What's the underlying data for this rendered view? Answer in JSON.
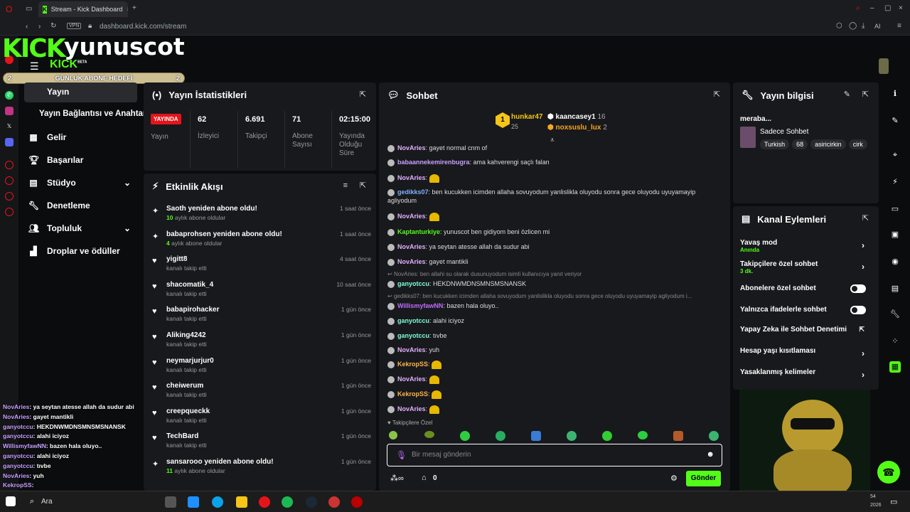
{
  "browser": {
    "tab_title": "Stream - Kick Dashboard",
    "vpn": "VPN",
    "url": "dashboard.kick.com/stream",
    "ai": "AI"
  },
  "header": {
    "logo": "KICK",
    "username": "yunuscot",
    "logo_small": "KICK",
    "beta": "BETA",
    "sub_goal_label": "GÜNLÜK ABONE HEDEFİ",
    "sub_goal_left": "2",
    "sub_goal_right": "2"
  },
  "nav": {
    "items": [
      {
        "label": "Yayın"
      },
      {
        "label": "Yayın Bağlantısı ve Anahtarı"
      },
      {
        "label": "Gelir"
      },
      {
        "label": "Başarılar"
      },
      {
        "label": "Stüdyo"
      },
      {
        "label": "Denetleme"
      },
      {
        "label": "Topluluk"
      },
      {
        "label": "Droplar ve ödüller"
      }
    ]
  },
  "stats": {
    "title": "Yayın İstatistikleri",
    "live_badge": "YAYINDA",
    "live_label": "Yayın",
    "items": [
      {
        "value": "62",
        "label": "İzleyici"
      },
      {
        "value": "6.691",
        "label": "Takipçi"
      },
      {
        "value": "71",
        "label": "Abone Sayısı"
      },
      {
        "value": "02:15:00",
        "label": "Yayında Olduğu Süre"
      }
    ]
  },
  "activity": {
    "title": "Etkinlik Akışı",
    "items": [
      {
        "name": "Saoth yeniden abone oldu!",
        "count": "10",
        "sub": "aylık abone oldular",
        "time": "1 saat önce",
        "icon": "sparkle-icon"
      },
      {
        "name": "babaprohsen yeniden abone oldu!",
        "count": "4",
        "sub": "aylık abone oldular",
        "time": "1 saat önce",
        "icon": "sparkle-icon"
      },
      {
        "name": "yigitt8",
        "count": "",
        "sub": "kanalı takip etti",
        "time": "4 saat önce",
        "icon": "heart-icon"
      },
      {
        "name": "shacomatik_4",
        "count": "",
        "sub": "kanalı takip etti",
        "time": "10 saat önce",
        "icon": "heart-icon"
      },
      {
        "name": "babapirohacker",
        "count": "",
        "sub": "kanalı takip etti",
        "time": "1 gün önce",
        "icon": "heart-icon"
      },
      {
        "name": "Aliking4242",
        "count": "",
        "sub": "kanalı takip etti",
        "time": "1 gün önce",
        "icon": "heart-icon"
      },
      {
        "name": "neymarjurjur0",
        "count": "",
        "sub": "kanalı takip etti",
        "time": "1 gün önce",
        "icon": "heart-icon"
      },
      {
        "name": "cheiwerum",
        "count": "",
        "sub": "kanalı takip etti",
        "time": "1 gün önce",
        "icon": "heart-icon"
      },
      {
        "name": "creepqueckk",
        "count": "",
        "sub": "kanalı takip etti",
        "time": "1 gün önce",
        "icon": "heart-icon"
      },
      {
        "name": "TechBard",
        "count": "",
        "sub": "kanalı takip etti",
        "time": "1 gün önce",
        "icon": "heart-icon"
      },
      {
        "name": "sansarooo yeniden abone oldu!",
        "count": "11",
        "sub": "aylık abone oldular",
        "time": "1 gün önce",
        "icon": "sparkle-icon"
      }
    ]
  },
  "chat": {
    "title": "Sohbet",
    "top": [
      {
        "rank": "1",
        "name": "hunkar47",
        "val": "25"
      },
      {
        "rank": "2",
        "name": "kaancasey1",
        "val": "16"
      },
      {
        "rank": "3",
        "name": "noxsuslu_lux",
        "val": "2"
      }
    ],
    "messages": [
      {
        "user": "NovAries",
        "color": "#e0b0ff",
        "text": "gayet normal cnm of",
        "kind": "msg"
      },
      {
        "user": "babaannekemirenbugra",
        "color": "#c9a0ff",
        "text": "ama kahverengi saçlı falan",
        "kind": "msg"
      },
      {
        "user": "NovAries",
        "color": "#e0b0ff",
        "text": "",
        "kind": "msg"
      },
      {
        "user": "gedikks07",
        "color": "#7fb2ff",
        "text": "ben kucukken icimden allaha sovuyodum yanlislikla oluyodu sonra gece oluyodu uyuyamayip agliyodum",
        "kind": "msg"
      },
      {
        "user": "NovAries",
        "color": "#e0b0ff",
        "text": "",
        "kind": "msg"
      },
      {
        "user": "Kaptanturkiye",
        "color": "#53fc18",
        "text": "yunuscot ben gidiyom beni özlicen mi",
        "kind": "msg"
      },
      {
        "user": "NovAries",
        "color": "#e0b0ff",
        "text": "ya seytan atesse allah da sudur abi",
        "kind": "msg"
      },
      {
        "user": "NovAries",
        "color": "#e0b0ff",
        "text": "gayet mantikli",
        "kind": "msg"
      },
      {
        "user": "",
        "color": "#888",
        "text": "NovAries: ben allahi su olarak dusunuyodum isimli kullanıcıya yanıt veriyor",
        "kind": "reply"
      },
      {
        "user": "ganyotccu",
        "color": "#7fffd4",
        "text": "HEKDNWMDNSMNSMSNANSK",
        "kind": "msg"
      },
      {
        "user": "",
        "color": "#888",
        "text": "gedikks07: ben kucukken icimden allaha sovuyodum yanlislikla oluyodu sonra gece oluyodu uyuyamayip agliyodum i...",
        "kind": "reply"
      },
      {
        "user": "WillismyfawNN",
        "color": "#c06bff",
        "text": "bazen hala oluyo..",
        "kind": "msg"
      },
      {
        "user": "ganyotccu",
        "color": "#7fffd4",
        "text": "alahi iciyoz",
        "kind": "msg"
      },
      {
        "user": "ganyotccu",
        "color": "#7fffd4",
        "text": "tıvbe",
        "kind": "msg"
      },
      {
        "user": "NovAries",
        "color": "#e0b0ff",
        "text": "yuh",
        "kind": "msg"
      },
      {
        "user": "KekropSS",
        "color": "#ffb347",
        "text": "",
        "kind": "msg"
      },
      {
        "user": "NovAries",
        "color": "#e0b0ff",
        "text": "",
        "kind": "msg"
      },
      {
        "user": "KekropSS",
        "color": "#ffb347",
        "text": "",
        "kind": "msg"
      },
      {
        "user": "NovAries",
        "color": "#e0b0ff",
        "text": "",
        "kind": "msg"
      }
    ],
    "followers_only": "Takipçilere Özel",
    "input_placeholder": "Bir mesaj gönderin",
    "points": "0",
    "send": "Gönder"
  },
  "info": {
    "title": "Yayın bilgisi",
    "stream_title": "meraba...",
    "category": "Sadece Sohbet",
    "tags": [
      "Turkish",
      "68",
      "asiricirkin",
      "cirk"
    ]
  },
  "actions": {
    "title": "Kanal Eylemleri",
    "items": [
      {
        "label": "Yavaş mod",
        "sub": "Anında",
        "type": "chevron"
      },
      {
        "label": "Takipçilere özel sohbet",
        "sub": "3 dk.",
        "type": "chevron"
      },
      {
        "label": "Abonelere özel sohbet",
        "sub": "",
        "type": "toggle"
      },
      {
        "label": "Yalnızca ifadelerle sohbet",
        "sub": "",
        "type": "toggle"
      },
      {
        "label": "Yapay Zeka ile Sohbet Denetimi",
        "sub": "",
        "type": "external"
      },
      {
        "label": "Hesap yaşı kısıtlaması",
        "sub": "",
        "type": "chevron"
      },
      {
        "label": "Yasaklanmış kelimeler",
        "sub": "",
        "type": "chevron"
      }
    ]
  },
  "overlay_chat": [
    {
      "user": "NovAries",
      "text": ": ya seytan atesse allah da sudur abi"
    },
    {
      "user": "NovAries",
      "text": ": gayet mantikli"
    },
    {
      "user": "ganyotccu",
      "text": ": HEKDNWMDNSMNSMSNANSK"
    },
    {
      "user": "ganyotccu",
      "text": ": alahi iciyoz"
    },
    {
      "user": "WillismyfawNN",
      "text": ": bazen hala oluyo.."
    },
    {
      "user": "ganyotccu",
      "text": ": alahi iciyoz"
    },
    {
      "user": "ganyotccu",
      "text": ": tıvbe"
    },
    {
      "user": "NovAries",
      "text": ": yuh"
    },
    {
      "user": "KekropSS",
      "text": ":"
    },
    {
      "user": "NovAries",
      "text": ":"
    }
  ],
  "taskbar": {
    "search": "Ara",
    "time": "54",
    "date": "2026"
  },
  "colors": {
    "accent": "#53fc18",
    "bg": "#0b0c0e",
    "panel": "#18191c",
    "live": "#e5141b"
  }
}
